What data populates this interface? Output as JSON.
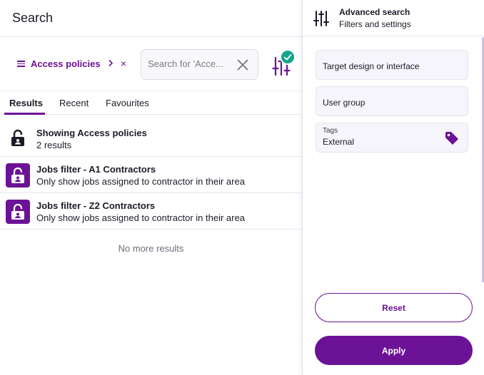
{
  "search": {
    "title": "Search",
    "filter_chip": {
      "label": "Access policies",
      "clear_glyph": "×"
    },
    "input": {
      "value": "",
      "placeholder": "Search for 'Acce..."
    },
    "tabs": [
      {
        "label": "Results",
        "active": true
      },
      {
        "label": "Recent",
        "active": false
      },
      {
        "label": "Favourites",
        "active": false
      }
    ],
    "summary": {
      "title": "Showing Access policies",
      "count": "2 results"
    },
    "results": [
      {
        "title": "Jobs filter - A1 Contractors",
        "description": "Only show jobs assigned to contractor in their area"
      },
      {
        "title": "Jobs filter - Z2 Contractors",
        "description": "Only show jobs assigned to contractor in their area"
      }
    ],
    "footer": "No more results"
  },
  "advanced": {
    "title": "Advanced search",
    "subtitle": "Filters and settings",
    "fields": {
      "target": "Target design or interface",
      "user_group": "User group",
      "tags": {
        "label": "Tags",
        "value": "External"
      }
    },
    "reset_label": "Reset",
    "apply_label": "Apply"
  },
  "colors": {
    "accent": "#6b1296",
    "check": "#13a58b",
    "text": "#1c1b29",
    "muted": "#6f6e7c"
  },
  "icons": {
    "chip": "menu-icon",
    "chip_arrow": "chevron-right-icon",
    "search_clear": "close-icon",
    "advanced_toggle": "sliders-icon",
    "advanced_active": "check-icon",
    "summary": "lock-icon",
    "result": "lock-user-icon",
    "tags": "tag-icon"
  }
}
